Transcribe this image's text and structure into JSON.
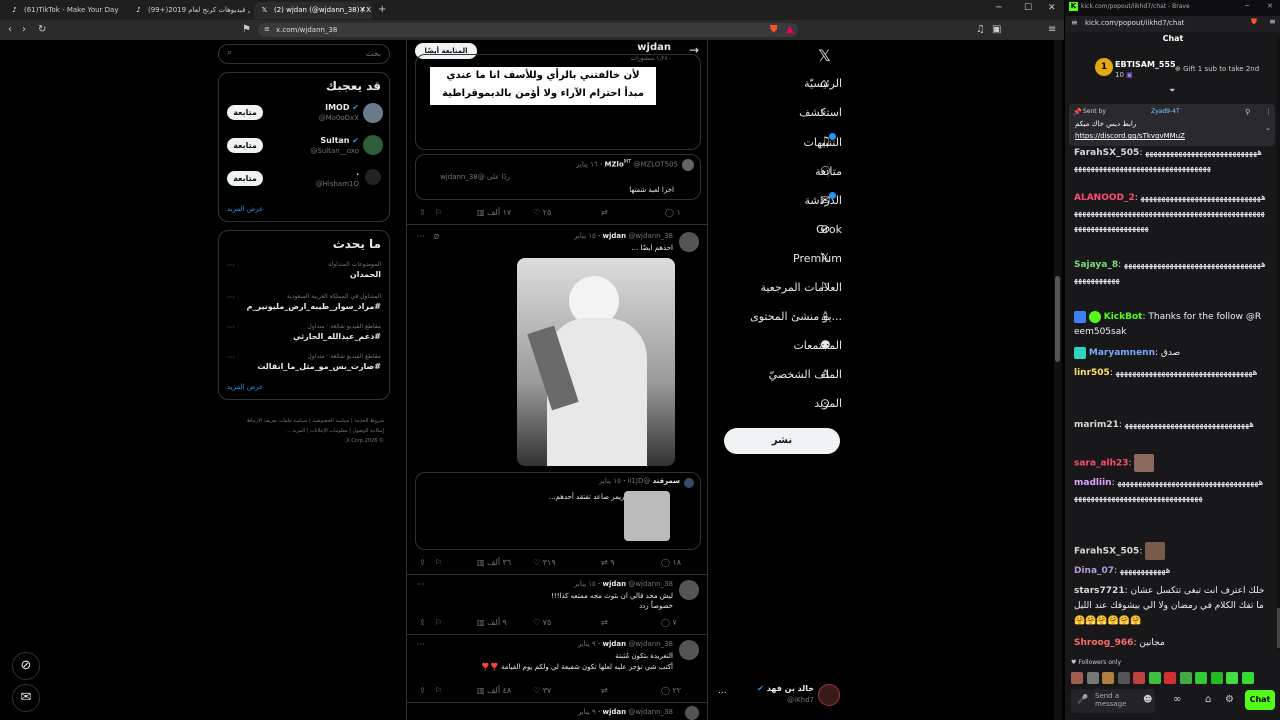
{
  "browser": {
    "tabs": [
      {
        "label": "(61)TikTok - Make Your Day",
        "active": false
      },
      {
        "label": "(99+)أفضل فيديوهات كرنج لعام 2019",
        "active": false
      },
      {
        "label": "(2) wjdan (@wjdann_38) / X",
        "active": true
      }
    ],
    "url": "x.com/wjdann_38"
  },
  "x": {
    "nav": [
      {
        "label": "الرئيسيّة",
        "icon": "home-icon"
      },
      {
        "label": "استكشف",
        "icon": "search-icon"
      },
      {
        "label": "التنبيهات",
        "icon": "bell-icon"
      },
      {
        "label": "متابعة",
        "icon": "follow-icon"
      },
      {
        "label": "الدردشة",
        "icon": "mail-icon"
      },
      {
        "label": "Grok",
        "icon": "grok-icon"
      },
      {
        "label": "Premium",
        "icon": "x-icon"
      },
      {
        "label": "العلامات المرجعية",
        "icon": "bookmark-icon"
      },
      {
        "label": "...يو منشئ المحتوى",
        "icon": "creator-icon"
      },
      {
        "label": "المجتمعات",
        "icon": "communities-icon"
      },
      {
        "label": "الملف الشخصيّ",
        "icon": "profile-icon"
      },
      {
        "label": "المزيد",
        "icon": "more-icon"
      }
    ],
    "post_button": "نشر",
    "account": {
      "name": "خالد بن فهد",
      "handle": "@iKhd7",
      "more": "..."
    },
    "profile_header": {
      "name": "wjdan",
      "posts": "١٫٢٨٠ منشورات",
      "follow_back": "المتابعة أيضًا"
    },
    "banner_text": [
      "لأن خالفتني بالرأي وللأسف انا ما عندي",
      "مبدأ احترام الآراء ولا أؤمن بالديموقراطية"
    ],
    "tweets": [
      {
        "name": "MZlo",
        "badge": "MT",
        "handle": "@MZLOT505",
        "date": "١٦ يناير",
        "reply_to": "ردًا على @wjdann_38",
        "text": "اخرا لعبة شفتها",
        "replies": "١",
        "retweets": "",
        "likes": "٢٥",
        "views": "١٧ ألف"
      },
      {
        "name": "wjdan",
        "handle": "@wjdann_38",
        "date": "١٥ يناير",
        "text": "احذهم ايضًا ...",
        "quote": {
          "name": "سمرقند",
          "handle": "@ii1JD",
          "date": "١٥ يناير",
          "text": "جائزة افضل ستريمر صاعد تفتقد أحدهم..."
        },
        "replies": "١٨",
        "retweets": "٩",
        "likes": "٣١٩",
        "views": "٣٦ ألف"
      },
      {
        "name": "wjdan",
        "handle": "@wjdann_38",
        "date": "١٥ يناير",
        "text": "ليش محد قالي ان بثوث مجه ممتعه كذا!!!\nخصوصاً ردد",
        "replies": "٧",
        "retweets": "",
        "likes": "٧٥",
        "views": "٩ ألف"
      },
      {
        "name": "wjdan",
        "handle": "@wjdann_38",
        "date": "٩ يناير",
        "text": "التغريدة بتكون مُثبتة\nأكتب شي تؤجر عليه لعلها تكون شفيعة لي ولكم يوم القيامة ❣️❣️",
        "replies": "٢٢",
        "retweets": "",
        "likes": "٣٧",
        "views": "٤٨ ألف"
      },
      {
        "name": "wjdan",
        "handle": "@wjdann_38",
        "date": "٩ يناير",
        "text": ""
      }
    ],
    "search_placeholder": "بحث",
    "who_to_follow": {
      "title": "قد يعجبك",
      "users": [
        {
          "name": "IMOD",
          "handle": "@Mo0oDxX",
          "verified": true,
          "follow": "متابعة"
        },
        {
          "name": "Sultan",
          "handle": "@Sultan__oxo",
          "verified": true,
          "follow": "متابعة"
        },
        {
          "name": ".",
          "handle": "@Hisham1O",
          "verified": false,
          "follow": "متابعة"
        }
      ],
      "show_more": "عرض المزيد"
    },
    "trends": {
      "title": "ما يحدث",
      "items": [
        {
          "context": "الموضوعات المتداولة",
          "name": "الحمدان"
        },
        {
          "context": "المتداول في المملكة العربية السعودية",
          "name": "#مراد_سوار_طيبه_ارض_مليونير_م"
        },
        {
          "context": "مقاطع الفيديو شائعة · متداول",
          "name": "#دعم_عبدالله_الحارثي"
        },
        {
          "context": "مقاطع الفيديو شائعة · متداول",
          "name": "#صارت_بس_مو_مثل_ما_انقالت"
        }
      ],
      "show_more": "عرض المزيد"
    },
    "footer": [
      "شروط الخدمة",
      "سياسة الخصوصية",
      "سياسة ملفات تعريف الارتباط",
      "إمكانية الوصول",
      "معلومات الإعلانات",
      "المزيد ...",
      "© 2026 X Corp."
    ]
  },
  "kick": {
    "window_url": "kick.com/popout/iikhd7/chat - Brave",
    "url": "kick.com/popout/iikhd7/chat",
    "title": "Chat",
    "top_gifter": {
      "name": "EBTISAM_555",
      "count": "10",
      "rank": "1",
      "gift_text": "Gift 1 sub to take 2nd"
    },
    "pinned": {
      "label": "Sent by",
      "user": "Zyad9-4T",
      "text": "رابط ديس خاك ميكم",
      "link": "https://discord.gg/sTkvgvMMuZ"
    },
    "messages": [
      {
        "user": "FarahSX_505",
        "color": "#d8d8d8",
        "text": "ﻫﻬﻬﻬﻬﻬﻬﻬﻬﻬﻬﻬﻬﻬﻬﻬﻬﻬﻬﻬﻬﻬﻬﻬﻬﻬﻬﻬﻬﻬﻬﻬﻬﻬﻬﻬﻬﻬﻬﻬﻬﻬﻬﻬﻬﻬﻬﻬﻬﻬﻬﻬﻬﻬﻬﻬﻬﻬﻬﻬﻬ"
      },
      {
        "user": "ALANOOD_2",
        "color": "#ff4d6d",
        "text": "ﻫﻬﻬﻬﻬﻬﻬﻬﻬﻬﻬﻬﻬﻬﻬﻬﻬﻬﻬﻬﻬﻬﻬﻬﻬﻬﻬﻬﻬﻬﻬﻬﻬﻬﻬﻬﻬﻬﻬﻬﻬﻬﻬﻬﻬﻬﻬﻬﻬﻬﻬﻬﻬﻬﻬﻬﻬﻬﻬﻬﻬﻬﻬﻬﻬﻬﻬﻬﻬﻬﻬﻬﻬﻬﻬﻬﻬﻬﻬﻬﻬﻬﻬﻬﻬﻬﻬﻬﻬﻬﻬﻬﻬﻬ"
      },
      {
        "user": "Sajaya_8",
        "color": "#7bdc7b",
        "text": "ﻫﻬﻬﻬﻬﻬﻬﻬﻬﻬﻬﻬﻬﻬﻬﻬﻬﻬﻬﻬﻬﻬﻬﻬﻬﻬﻬﻬﻬﻬﻬﻬﻬﻬﻬﻬﻬﻬﻬﻬﻬﻬﻬﻬﻬ"
      },
      {
        "user": "KickBot",
        "color": "#53fc18",
        "text": "Thanks for the follow @Reem505sak"
      },
      {
        "user": "Maryamnenn",
        "color": "#7aa8ff",
        "text": "صدق"
      },
      {
        "user": "linr505",
        "color": "#ffe066",
        "text": "ﻫﻬﻬﻬﻬﻬﻬﻬﻬﻬﻬﻬﻬﻬﻬﻬﻬﻬﻬﻬﻬﻬﻬﻬﻬﻬﻬﻬﻬﻬﻬﻬﻬﻬ"
      },
      {
        "user": "marim21",
        "color": "#d8d8d8",
        "text": "ﻫﻬﻬﻬﻬﻬﻬﻬﻬﻬﻬﻬﻬﻬﻬﻬﻬﻬﻬﻬﻬﻬﻬﻬﻬﻬﻬﻬﻬﻬﻬ"
      },
      {
        "user": "sara_alh23",
        "color": "#ff4d6d",
        "text": ""
      },
      {
        "user": "madliin",
        "color": "#e0a0ff",
        "text": "ﻫﻬﻬﻬﻬﻬﻬﻬﻬﻬﻬﻬﻬﻬﻬﻬﻬﻬﻬﻬﻬﻬﻬﻬﻬﻬﻬﻬﻬﻬﻬﻬﻬﻬﻬﻬﻬﻬﻬﻬﻬﻬﻬﻬﻬﻬﻬﻬﻬﻬﻬﻬﻬﻬﻬﻬﻬﻬﻬﻬﻬﻬﻬﻬﻬﻬ"
      },
      {
        "user": "FarahSX_505",
        "color": "#d8d8d8",
        "text": ""
      },
      {
        "user": "Dina_07",
        "color": "#b39ddb",
        "text": "ﻫﻬﻬﻬﻬﻬﻬﻬﻬﻬﻬﻬ"
      },
      {
        "user": "stars7721",
        "color": "#d8d8d8",
        "text": "خلك اعترف انت تبغى تتكسل عشان ما تفك الكلام في رمضان ولا الي بيشوفك عند الليل 🤗🤗🤗🤗🤗🤗"
      },
      {
        "user": "Shroog_966",
        "color": "#ff6b6b",
        "text": "مجانين"
      }
    ],
    "followers_only": "Followers only",
    "send_placeholder": "Send a message",
    "chat_button": "Chat",
    "colors": {
      "kick_green": "#53fc18",
      "x_blue": "#1d9bf0",
      "chat_bg": "#18181b"
    }
  }
}
